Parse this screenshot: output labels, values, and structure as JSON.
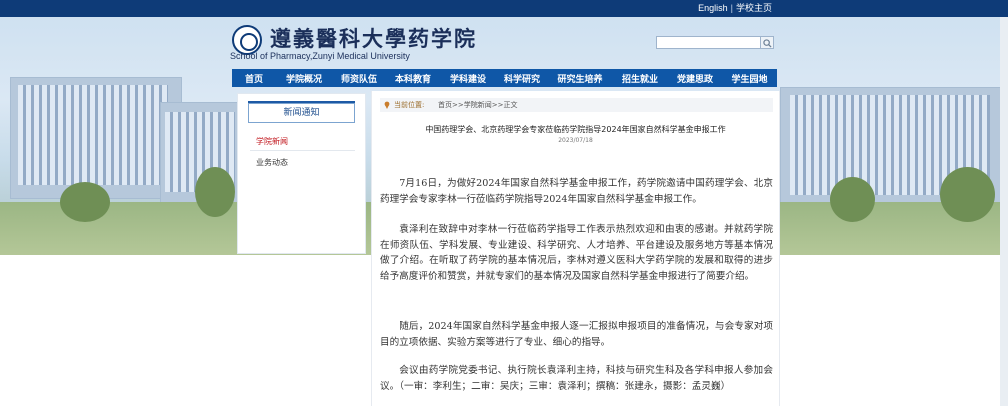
{
  "top_links": {
    "english": "English",
    "separator": "|",
    "home": "学校主页"
  },
  "header": {
    "school_name": "遵義醫科大學药学院",
    "school_name_en": "School of Pharmacy,Zunyi Medical University"
  },
  "search": {
    "placeholder": "",
    "button_icon": "search-icon"
  },
  "nav": [
    "首页",
    "学院概况",
    "师资队伍",
    "本科教育",
    "学科建设",
    "科学研究",
    "研究生培养",
    "招生就业",
    "党建思政",
    "学生园地"
  ],
  "sidebar": {
    "title": "新闻通知",
    "items": [
      {
        "label": "学院新闻",
        "active": true
      },
      {
        "label": "业务动态",
        "active": false
      }
    ]
  },
  "breadcrumb": {
    "label": "当前位置:",
    "home": "首页",
    "sep1": ">>",
    "section": "学院新闻",
    "sep2": ">>",
    "current": "正文"
  },
  "article": {
    "title": "中国药理学会、北京药理学会专家莅临药学院指导2024年国家自然科学基金申报工作",
    "date": "2023/07/18",
    "paragraphs": [
      "7月16日，为做好2024年国家自然科学基金申报工作，药学院邀请中国药理学会、北京药理学会专家李林一行莅临药学院指导2024年国家自然科学基金申报工作。",
      "袁泽利在致辞中对李林一行莅临药学指导工作表示热烈欢迎和由衷的感谢。并就药学院在师资队伍、学科发展、专业建设、科学研究、人才培养、平台建设及服务地方等基本情况做了介绍。在听取了药学院的基本情况后，李林对遵义医科大学药学院的发展和取得的进步给予高度评价和赞赏，并就专家们的基本情况及国家自然科学基金申报进行了简要介绍。",
      "随后，2024年国家自然科学基金申报人逐一汇报拟申报项目的准备情况，与会专家对项目的立项依据、实验方案等进行了专业、细心的指导。",
      "会议由药学院党委书记、执行院长袁泽利主持，科技与研究生科及各学科申报人参加会议。（一审：李利生；二审：吴庆；三审：袁泽利；撰稿：张建永，摄影：孟灵巍）"
    ]
  },
  "colors": {
    "topbar": "#0e3b78",
    "nav": "#0f57a7",
    "active_sidebar": "#c0141b",
    "date_accent": "#777777"
  }
}
